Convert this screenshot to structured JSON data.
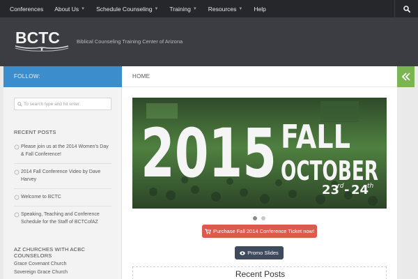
{
  "nav": {
    "items": [
      {
        "label": "Conferences",
        "dropdown": false
      },
      {
        "label": "About Us",
        "dropdown": true
      },
      {
        "label": "Schedule Counseling",
        "dropdown": true
      },
      {
        "label": "Training",
        "dropdown": true
      },
      {
        "label": "Resources",
        "dropdown": true
      },
      {
        "label": "Help",
        "dropdown": false
      }
    ],
    "search_icon": "search-icon"
  },
  "header": {
    "logo": "BCTC",
    "tagline": "Biblical Counseling Training Center of Arizona"
  },
  "sidebar": {
    "follow_label": "FOLLOW:",
    "search_placeholder": "To search type and hit enter",
    "recent_posts_heading": "RECENT POSTS",
    "recent_posts": [
      "Please join us at the 2014 Women's Day & Fall Conference!",
      "2014 Fall Conference Video by Dave Harvey",
      "Welcome to BCTC",
      "Speaking, Teaching and Conference Schedule for the Staff of BCTCofAZ"
    ],
    "churches_heading": "AZ CHURCHES WITH ACBC COUNSELORS",
    "churches": [
      "Grace Covenant Church",
      "Sovereign Grace Church"
    ]
  },
  "main": {
    "breadcrumb": "HOME",
    "slide": {
      "year": "2015",
      "season": "FALL",
      "month": "OCTOBER",
      "day_start": "23",
      "day_start_suffix": "rd",
      "dash": "-",
      "day_end": "24",
      "day_end_suffix": "th"
    },
    "slide_count": 2,
    "active_slide": 1,
    "ticket_button": "Purchase Fall 2014 Conference Ticket now!",
    "promo_button": "Promo Slides",
    "recent_posts_title": "Recent Posts"
  },
  "colors": {
    "nav_bg": "#26272b",
    "header_bg": "#3b3d42",
    "follow_bg": "#3b8dcb",
    "collapse_bg": "#7ab552",
    "slide_green": "#5e9a4a",
    "ticket_btn": "#dd5a4a",
    "promo_btn": "#3d4b5c"
  }
}
